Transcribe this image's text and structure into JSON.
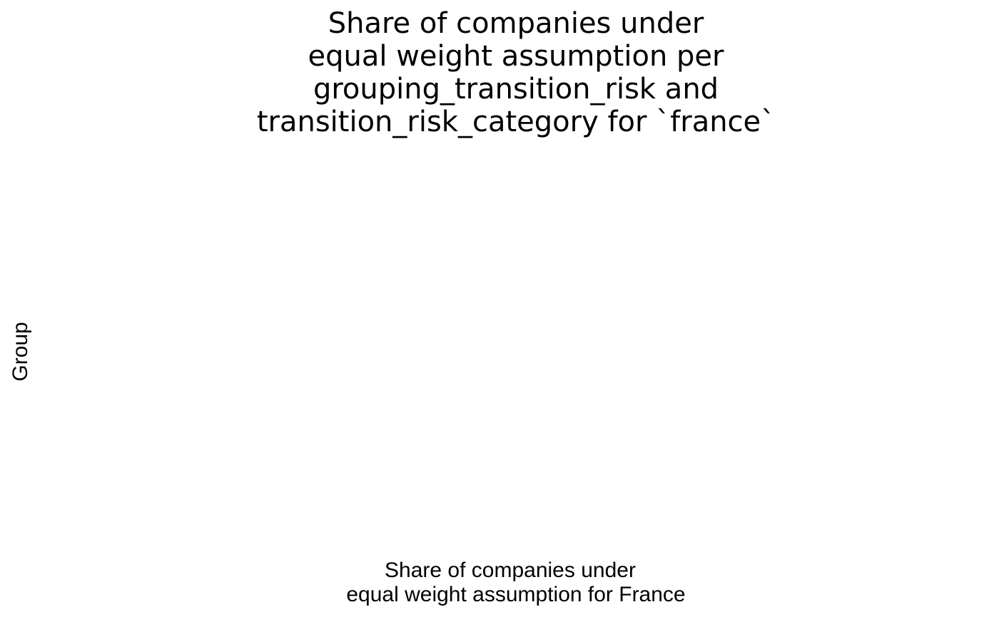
{
  "chart_data": {
    "type": "bar",
    "title": [
      "Share of companies under",
      "equal weight assumption per",
      "grouping_transition_risk and",
      "transition_risk_category for `france`"
    ],
    "xlabel": [
      "Share of companies under",
      "equal weight assumption for France"
    ],
    "ylabel": "Group",
    "categories": [],
    "series": [],
    "grid": false,
    "legend": "none"
  }
}
